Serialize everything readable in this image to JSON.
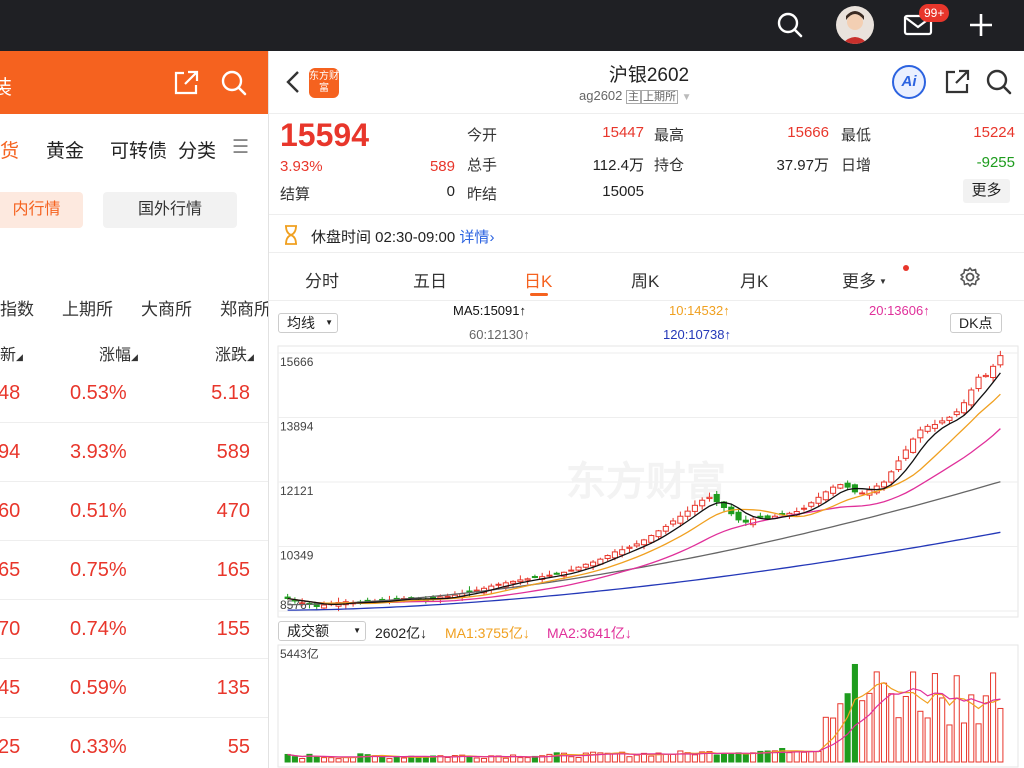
{
  "topbar": {
    "badge": "99+"
  },
  "left": {
    "head_partial": "装",
    "tabs": [
      "货",
      "黄金",
      "可转债",
      "分类"
    ],
    "pill_active": "内行情",
    "pill_inactive": "国外行情",
    "exchanges": [
      "指数",
      "上期所",
      "大商所",
      "郑商所"
    ],
    "columns": [
      "新",
      "涨幅",
      "涨跌"
    ],
    "rows": [
      {
        "price": "48",
        "pct": "0.53%",
        "chg": "5.18"
      },
      {
        "price": "94",
        "pct": "3.93%",
        "chg": "589"
      },
      {
        "price": "60",
        "pct": "0.51%",
        "chg": "470"
      },
      {
        "price": "65",
        "pct": "0.75%",
        "chg": "165"
      },
      {
        "price": "70",
        "pct": "0.74%",
        "chg": "155"
      },
      {
        "price": "45",
        "pct": "0.59%",
        "chg": "135"
      },
      {
        "price": "25",
        "pct": "0.33%",
        "chg": "55"
      }
    ]
  },
  "header": {
    "logo": "东方财富",
    "title": "沪银2602",
    "code": "ag2602",
    "tag_main": "主",
    "tag_exchange": "上期所",
    "ai": "Ai"
  },
  "quote": {
    "price": "15594",
    "pct": "3.93%",
    "chg": "589",
    "settle_label": "结算",
    "settle": "0",
    "open_label": "今开",
    "open": "15447",
    "vol_label": "总手",
    "vol": "112.4万",
    "prev_label": "昨结",
    "prev": "15005",
    "high_label": "最高",
    "high": "15666",
    "oi_label": "持仓",
    "oi": "37.97万",
    "low_label": "最低",
    "low": "15224",
    "oichg_label": "日增",
    "oichg": "-9255",
    "more": "更多"
  },
  "notice": {
    "text": "休盘时间 02:30-09:00",
    "link": "详情"
  },
  "tabs": [
    "分时",
    "五日",
    "日K",
    "周K",
    "月K",
    "更多"
  ],
  "ma": {
    "dropdown": "均线",
    "ma5": "MA5:15091↑",
    "ma10": "10:14532↑",
    "ma20": "20:13606↑",
    "ma60": "60:12130↑",
    "ma120": "120:10738↑",
    "dk": "DK点"
  },
  "vol": {
    "dropdown": "成交额",
    "value": "2602亿↓",
    "ma1": "MA1:3755亿↓",
    "ma2": "MA2:3641亿↓",
    "max": "5443亿"
  },
  "watermark": "东方财富",
  "colors": {
    "up": "#e8362b",
    "down": "#1e9c1e",
    "ma5": "#111111",
    "ma10": "#f0a020",
    "ma20": "#e0309a",
    "ma60": "#666666",
    "ma120": "#2438b8"
  },
  "chart_data": {
    "type": "candlestick",
    "title": "沪银2602 日K",
    "y_ticks": [
      15666,
      13894,
      12121,
      10349,
      8576
    ],
    "ylim": [
      8576,
      15666
    ],
    "close": [
      8920,
      8860,
      8800,
      8760,
      8700,
      8740,
      8780,
      8810,
      8830,
      8800,
      8790,
      8820,
      8850,
      8880,
      8860,
      8900,
      8920,
      8940,
      8900,
      8880,
      8910,
      8960,
      8980,
      9010,
      9050,
      9100,
      9150,
      9200,
      9260,
      9310,
      9350,
      9390,
      9430,
      9460,
      9500,
      9520,
      9560,
      9600,
      9640,
      9700,
      9780,
      9860,
      9920,
      10000,
      10100,
      10200,
      10260,
      10330,
      10420,
      10530,
      10650,
      10780,
      10900,
      11050,
      11180,
      11320,
      11480,
      11620,
      11700,
      11580,
      11420,
      11250,
      11080,
      11020,
      11100,
      11160,
      11120,
      11180,
      11220,
      11260,
      11310,
      11400,
      11550,
      11700,
      11850,
      11980,
      12050,
      11980,
      11850,
      11820,
      11900,
      12010,
      12120,
      12400,
      12700,
      13000,
      13300,
      13550,
      13650,
      13700,
      13800,
      13900,
      14050,
      14300,
      14650,
      15000,
      15050,
      15300,
      15594
    ],
    "ma_last": {
      "MA5": 15091,
      "MA10": 14532,
      "MA20": 13606,
      "MA60": 12130,
      "MA120": 10738
    },
    "volume_max": 5443,
    "volume_last": 2602,
    "volume_unit": "亿"
  }
}
